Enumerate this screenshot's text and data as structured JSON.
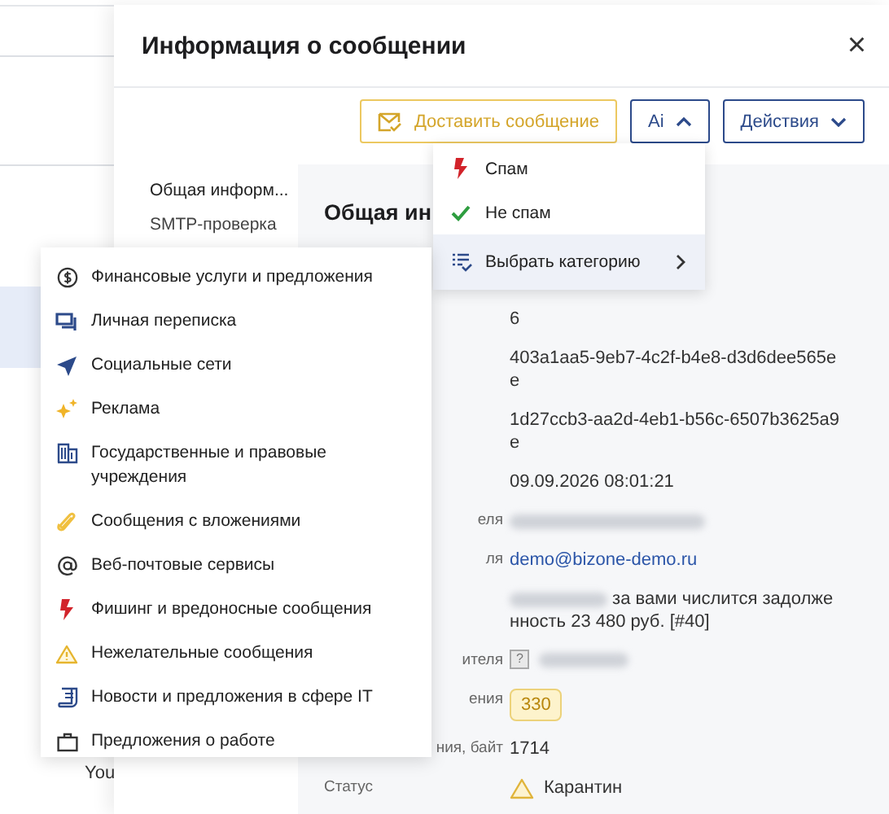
{
  "background": {
    "rows": [
      {
        "selected": false
      },
      {
        "selected": false
      },
      {
        "selected": true
      }
    ],
    "footer_text": "You"
  },
  "dialog": {
    "title": "Информация о сообщении",
    "close": "×",
    "toolbar": {
      "deliver_button": "Доставить сообщение",
      "ai_button": {
        "label": "Ai",
        "expanded": true
      },
      "actions_button": {
        "label": "Действия",
        "expanded": false
      }
    },
    "nav": [
      {
        "label": "Общая информ...",
        "selected": true
      },
      {
        "label": "SMTP-проверка",
        "selected": false
      }
    ],
    "section_title": "Общая ин",
    "fields": [
      {
        "kind": "text",
        "value": "6"
      },
      {
        "kind": "text",
        "value": "403a1aa5-9eb7-4c2f-b4e8-d3d6dee565ee"
      },
      {
        "kind": "text",
        "value": "1d27ccb3-aa2d-4eb1-b56c-6507b3625a9e"
      },
      {
        "kind": "text",
        "value": "09.09.2026 08:01:21"
      },
      {
        "kind": "redacted",
        "label": "еля"
      },
      {
        "kind": "link",
        "label": "ля",
        "value": "demo@bizone-demo.ru"
      },
      {
        "kind": "subject",
        "value": "за вами числится задолженность 23 480 руб. [#40]"
      },
      {
        "kind": "ip",
        "label": "ителя",
        "value": "?"
      },
      {
        "kind": "badge",
        "label": "ения",
        "value": "330"
      },
      {
        "kind": "text",
        "label": "ния, байт",
        "value": "1714"
      },
      {
        "kind": "status",
        "label": "Статус",
        "value": "Карантин"
      }
    ]
  },
  "ai_menu": [
    {
      "kind": "spam",
      "label": "Спам",
      "selected": false
    },
    {
      "kind": "ham",
      "label": "Не спам",
      "selected": false
    },
    {
      "kind": "submenu",
      "label": "Выбрать категорию",
      "selected": true
    }
  ],
  "categories": [
    {
      "label": "Финансовые услуги и предложения"
    },
    {
      "label": "Личная переписка"
    },
    {
      "label": "Социальные сети"
    },
    {
      "label": "Реклама"
    },
    {
      "label": "Государственные и правовые учреждения"
    },
    {
      "label": "Сообщения с вложениями"
    },
    {
      "label": "Веб-почтовые сервисы"
    },
    {
      "label": "Фишинг и вредоносные сообщения"
    },
    {
      "label": "Нежелательные сообщения"
    },
    {
      "label": "Новости и предложения в сфере IT"
    },
    {
      "label": "Предложения о работе"
    }
  ]
}
